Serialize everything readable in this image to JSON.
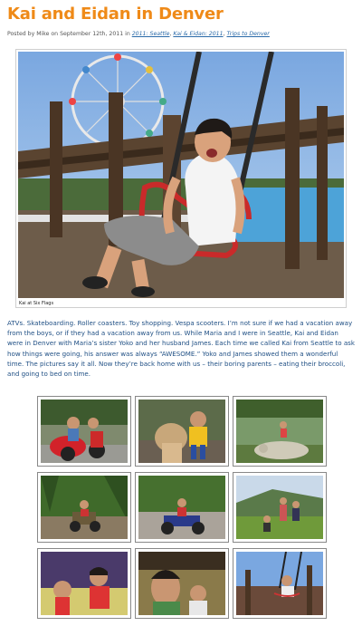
{
  "post": {
    "title": "Kai and Eidan in Denver",
    "posted_by": "Posted by Mike on September 12th, 2011 in",
    "categories": [
      "2011: Seattle",
      "Kai & Eidan: 2011",
      "Trips to Denver"
    ],
    "separator": ", ",
    "hero_caption": "Kai at Six Flags",
    "body": "ATVs. Skateboarding. Roller coasters. Toy shopping. Vespa scooters. I’m not sure if we had a vacation away from the boys, or if they had a vacation away from us. While Maria and I were in Seattle, Kai and Eidan were in Denver with Maria’s sister Yoko and her husband James. Each time we called Kai from Seattle to ask how things were going, his answer was always “AWESOME.” Yoko and James showed them a wonderful time. The pictures say it all. Now they’re back home with us – their boring parents – eating their broccoli, and going to bed on time."
  },
  "colors": {
    "title": "#ef8a18",
    "link": "#2a6aa8",
    "body_text": "#1f4f84"
  },
  "gallery_count": 9
}
